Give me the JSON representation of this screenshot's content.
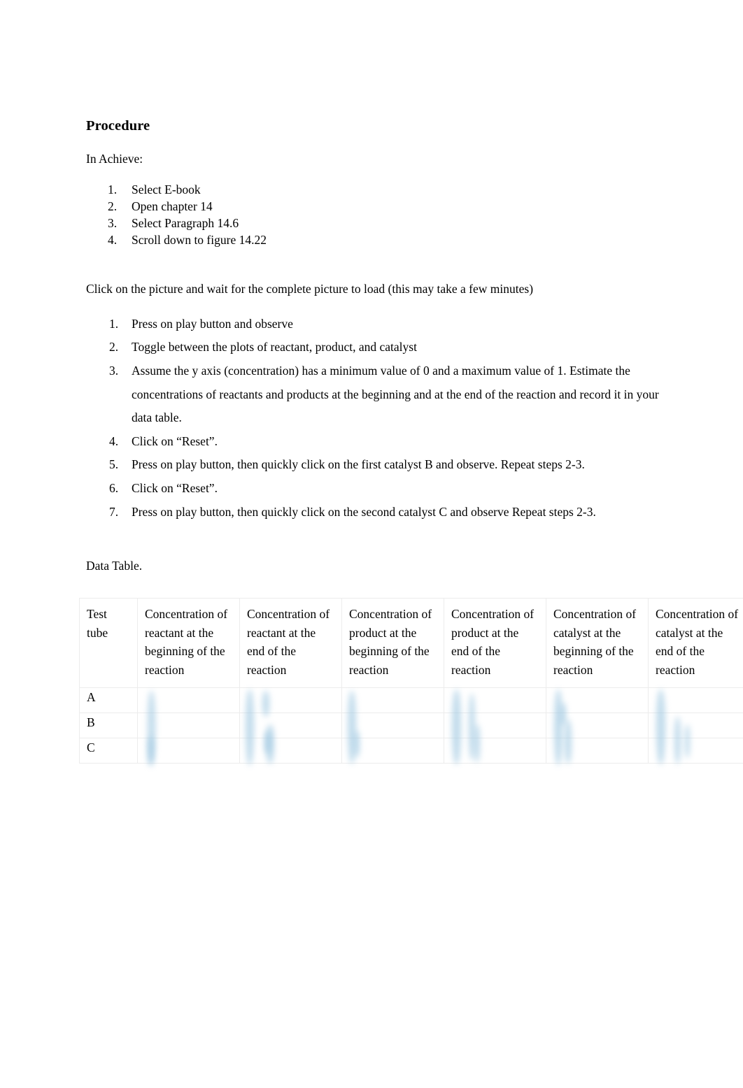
{
  "document": {
    "heading": "Procedure",
    "intro": "In Achieve:",
    "achieve_steps": [
      {
        "num": "1.",
        "text": "Select E-book"
      },
      {
        "num": "2.",
        "text": "Open chapter 14"
      },
      {
        "num": "3.",
        "text": "Select Paragraph 14.6"
      },
      {
        "num": "4.",
        "text": "Scroll down to figure 14.22"
      }
    ],
    "click_note": "Click on the picture and wait for the complete picture to load (this may take a few minutes)",
    "simulation_steps": [
      {
        "num": "1.",
        "text": "Press on play button and observe"
      },
      {
        "num": "2.",
        "text": "Toggle between the plots of reactant, product, and catalyst"
      },
      {
        "num": "3.",
        "text": "Assume the y axis (concentration) has a minimum value of 0 and a maximum value of 1. Estimate the concentrations of reactants and products at the beginning and at the end of the reaction and record it in your data table."
      },
      {
        "num": "4.",
        "text": "Click on “Reset”."
      },
      {
        "num": "5.",
        "text": "Press on play button, then quickly click on the first catalyst B and observe. Repeat steps 2-3."
      },
      {
        "num": "6.",
        "text": "Click on “Reset”."
      },
      {
        "num": "7.",
        "text": "Press on play button, then quickly click on the second catalyst C and observe Repeat steps 2-3."
      }
    ],
    "data_table_caption": "Data Table."
  },
  "data_table": {
    "headers": [
      "Test tube",
      "Concentration of reactant at the beginning of the reaction",
      "Concentration of reactant at the end of the reaction",
      "Concentration of product at the beginning of the reaction",
      "Concentration of product at the end of the reaction",
      "Concentration of catalyst at the beginning of the reaction",
      "Concentration of catalyst at the end of the reaction"
    ],
    "rows": [
      {
        "label": "A",
        "values": [
          "",
          "",
          "",
          "",
          "",
          ""
        ]
      },
      {
        "label": "B",
        "values": [
          "",
          "",
          "",
          "",
          "",
          ""
        ]
      },
      {
        "label": "C",
        "values": [
          "",
          "",
          "",
          "",
          "",
          ""
        ]
      }
    ],
    "cell_content_state": "blurred",
    "border_color": "#ececec",
    "blur_ink_color": "#9cc6e0"
  }
}
